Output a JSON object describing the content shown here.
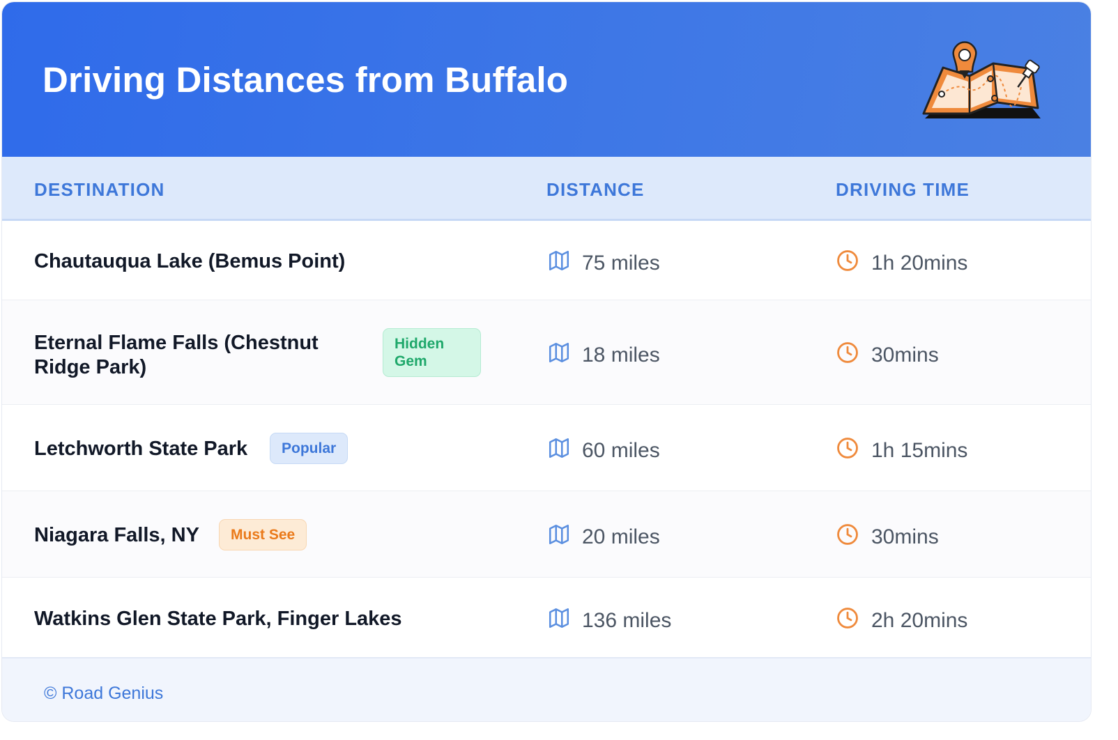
{
  "header": {
    "title": "Driving Distances from Buffalo"
  },
  "table": {
    "columns": [
      "DESTINATION",
      "DISTANCE",
      "DRIVING TIME"
    ],
    "rows": [
      {
        "destination_lines": [
          "Chautauqua Lake (Bemus Point)"
        ],
        "badge": "",
        "distance": "75 miles",
        "time": "1h 20mins"
      },
      {
        "destination_lines": [
          "Eternal Flame Falls (Chestnut",
          "Ridge Park)"
        ],
        "badge": "Hidden Gem",
        "badge_lines": [
          "Hidden",
          "Gem"
        ],
        "distance": "18 miles",
        "time": "30mins"
      },
      {
        "destination_lines": [
          "Letchworth State Park"
        ],
        "badge": "Popular",
        "distance": "60 miles",
        "time": "1h 15mins"
      },
      {
        "destination_lines": [
          "Niagara Falls, NY"
        ],
        "badge": "Must See",
        "distance": "20 miles",
        "time": "30mins"
      },
      {
        "destination_lines": [
          "Watkins Glen State Park, Finger Lakes"
        ],
        "badge": "",
        "distance": "136 miles",
        "time": "2h 20mins"
      }
    ],
    "distance_icon": "map-icon",
    "time_icon": "clock-icon"
  },
  "footer": {
    "copyright": "© Road Genius"
  },
  "colors": {
    "header_gradient_start": "#2f6bea",
    "header_gradient_end": "#4a80e3",
    "accent_blue": "#3d77d9",
    "orange": "#ef8a3c",
    "green": "#1fa86b"
  }
}
